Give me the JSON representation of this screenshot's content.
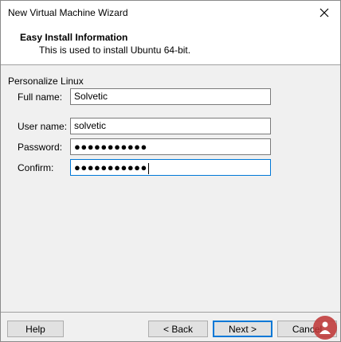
{
  "window": {
    "title": "New Virtual Machine Wizard"
  },
  "header": {
    "title": "Easy Install Information",
    "subtitle": "This is used to install Ubuntu 64-bit."
  },
  "form": {
    "group_label": "Personalize Linux",
    "full_name_label": "Full name:",
    "full_name_value": "Solvetic",
    "user_name_label": "User name:",
    "user_name_value": "solvetic",
    "password_label": "Password:",
    "password_value": "●●●●●●●●●●●",
    "confirm_label": "Confirm:",
    "confirm_value": "●●●●●●●●●●●"
  },
  "buttons": {
    "help": "Help",
    "back": "< Back",
    "next": "Next >",
    "cancel": "Cancel"
  },
  "colors": {
    "focus_border": "#0078d7",
    "watermark": "#be3232"
  },
  "icons": {
    "close": "close-icon",
    "watermark": "person-logo-icon"
  }
}
